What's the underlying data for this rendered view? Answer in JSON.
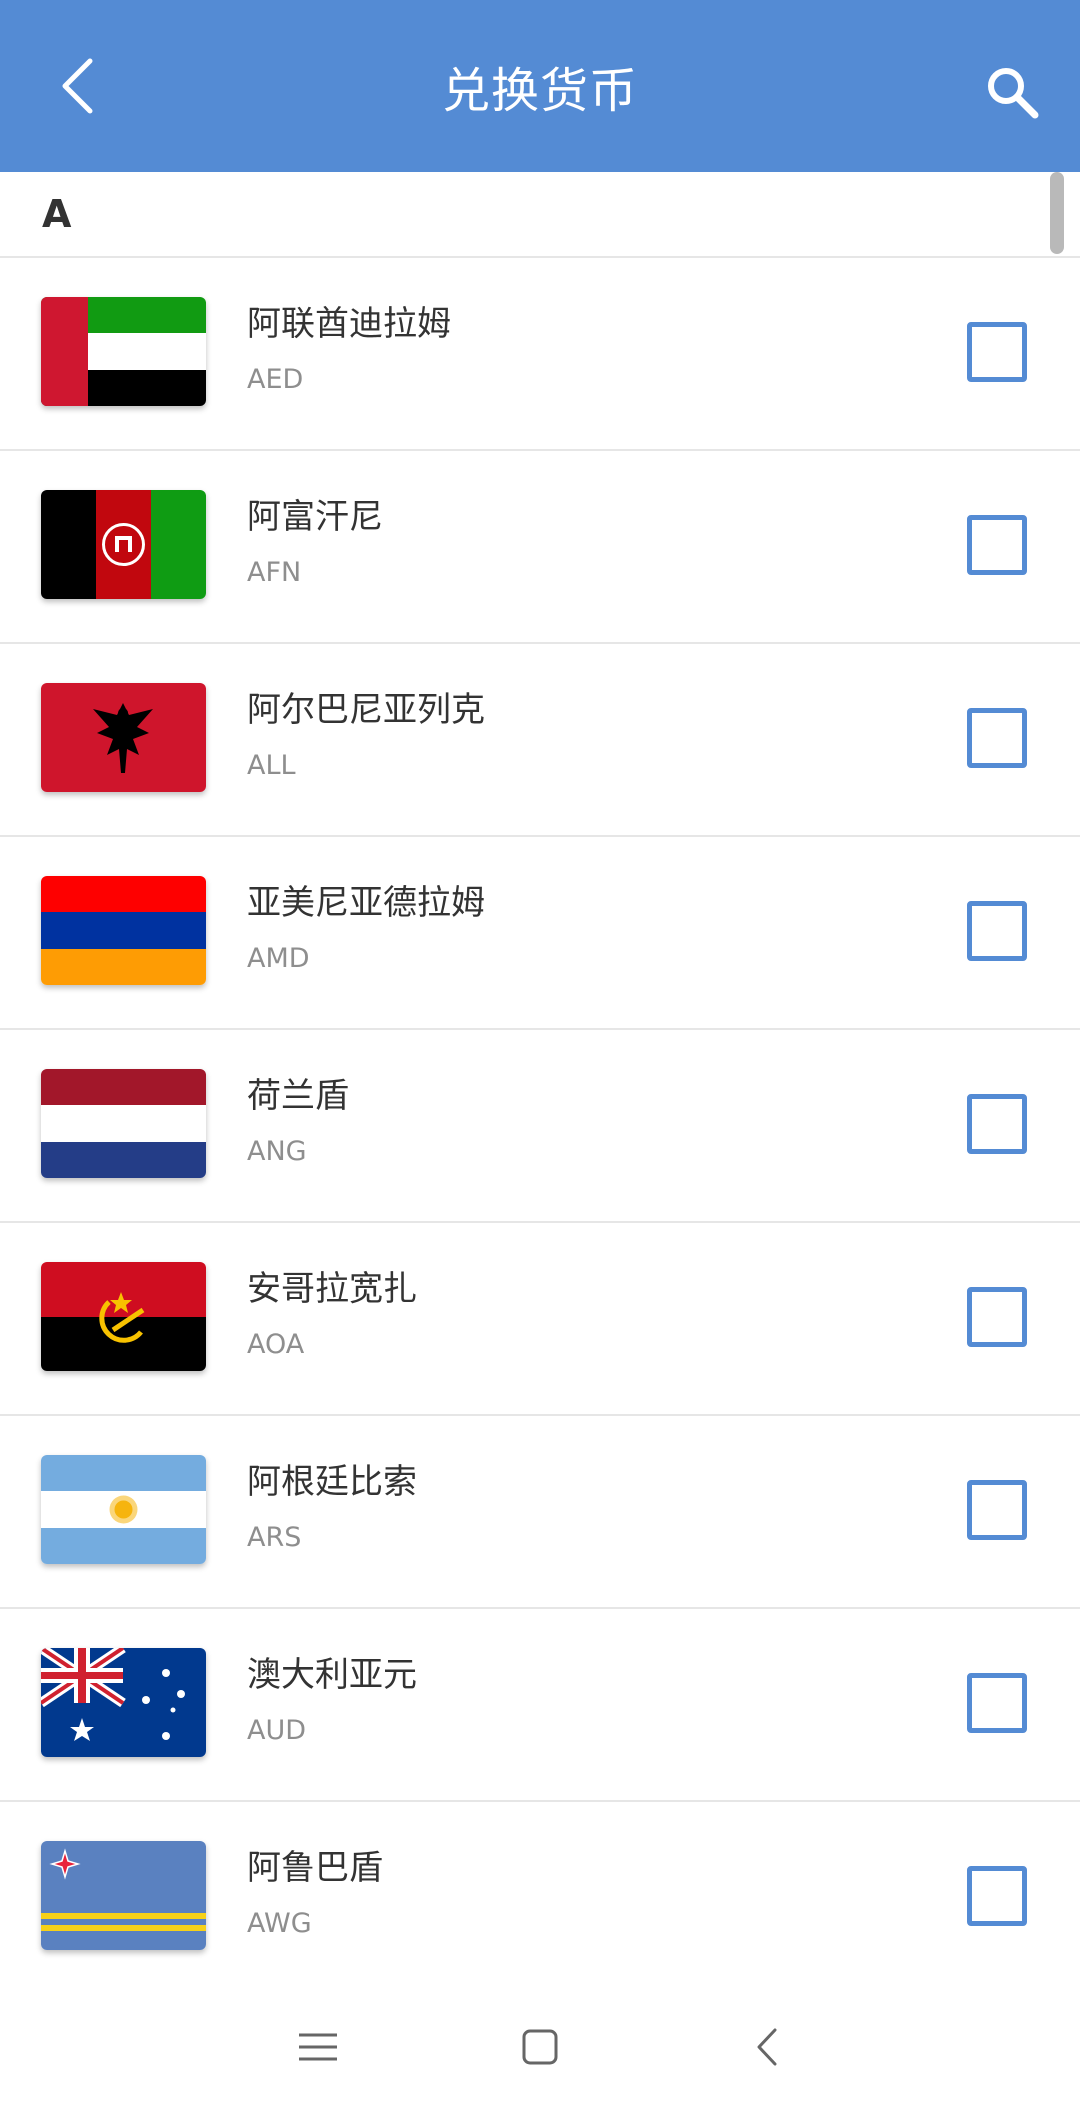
{
  "header": {
    "title": "兑换货币",
    "back_icon": "chevron-left-icon",
    "search_icon": "search-icon"
  },
  "section": {
    "letter": "A"
  },
  "currencies": [
    {
      "name": "阿联酋迪拉姆",
      "code": "AED",
      "flag": "uae-flag",
      "checked": false
    },
    {
      "name": "阿富汗尼",
      "code": "AFN",
      "flag": "afghanistan-flag",
      "checked": false
    },
    {
      "name": "阿尔巴尼亚列克",
      "code": "ALL",
      "flag": "albania-flag",
      "checked": false
    },
    {
      "name": "亚美尼亚德拉姆",
      "code": "AMD",
      "flag": "armenia-flag",
      "checked": false
    },
    {
      "name": "荷兰盾",
      "code": "ANG",
      "flag": "netherlands-flag",
      "checked": false
    },
    {
      "name": "安哥拉宽扎",
      "code": "AOA",
      "flag": "angola-flag",
      "checked": false
    },
    {
      "name": "阿根廷比索",
      "code": "ARS",
      "flag": "argentina-flag",
      "checked": false
    },
    {
      "name": "澳大利亚元",
      "code": "AUD",
      "flag": "australia-flag",
      "checked": false
    },
    {
      "name": "阿鲁巴盾",
      "code": "AWG",
      "flag": "aruba-flag",
      "checked": false
    }
  ],
  "navbar": {
    "menu_icon": "menu-icon",
    "home_icon": "home-square-icon",
    "back_icon": "back-triangle-icon"
  },
  "colors": {
    "primary": "#548bd4",
    "divider": "#e6e6e6",
    "text_primary": "#333333",
    "text_secondary": "#8e8e8e"
  }
}
